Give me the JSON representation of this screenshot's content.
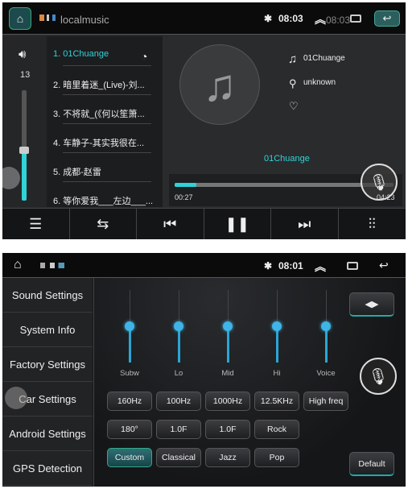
{
  "player": {
    "status": {
      "app": "localmusic",
      "time": "08:03",
      "time_overlay": "08:03"
    },
    "volume": {
      "value": "13",
      "level_fraction": 0.45
    },
    "playlist": [
      {
        "label": "1. 01Chuange",
        "active": true
      },
      {
        "label": "2. 暗里着迷_(Live)-刘..."
      },
      {
        "label": "3. 不将就_(《何以笙箫..."
      },
      {
        "label": "4. 车静子-其实我很在..."
      },
      {
        "label": "5. 成都-赵雷"
      },
      {
        "label": "6. 等你爱我___左边___..."
      }
    ],
    "info": {
      "title": "01Chuange",
      "artist": "unknown",
      "now_playing": "01Chuange"
    },
    "progress": {
      "elapsed": "00:27",
      "total": "04:23",
      "fraction": 0.1
    },
    "accent": "#2fd3d8"
  },
  "settings": {
    "status": {
      "time": "08:01"
    },
    "sidebar": [
      "Sound Settings",
      "System Info",
      "Factory Settings",
      "Car Settings",
      "Android Settings",
      "GPS Detection"
    ],
    "eq_bands": [
      {
        "label": "Subw",
        "freq": "160Hz",
        "extra": "180°"
      },
      {
        "label": "Lo",
        "freq": "100Hz",
        "extra": "1.0F"
      },
      {
        "label": "Mid",
        "freq": "1000Hz",
        "extra": "1.0F"
      },
      {
        "label": "Hi",
        "freq": "12.5KHz",
        "extra": "Rock"
      },
      {
        "label": "Voice",
        "freq": "High freq"
      }
    ],
    "eq_level_fraction": 0.5,
    "presets": [
      "Custom",
      "Classical",
      "Jazz",
      "Pop"
    ],
    "active_preset": "Custom",
    "default_label": "Default",
    "accent": "#3fb4e6"
  }
}
